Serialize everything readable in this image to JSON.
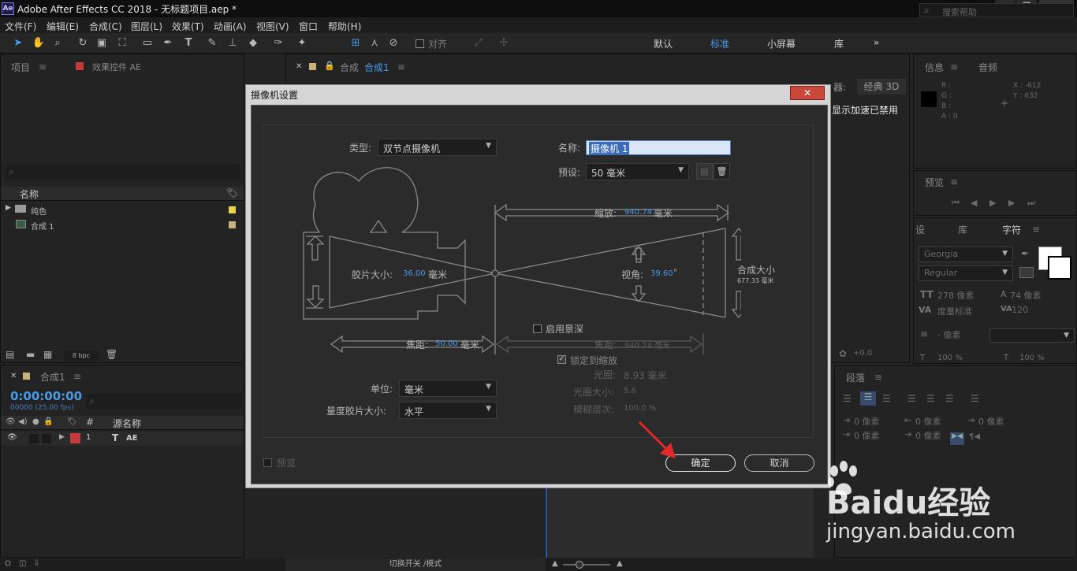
{
  "window": {
    "app_icon": "Ae",
    "title": "Adobe After Effects CC 2018 - 无标题项目.aep *",
    "min": "—",
    "max": "❐",
    "close": "✕"
  },
  "menu": [
    "文件(F)",
    "编辑(E)",
    "合成(C)",
    "图层(L)",
    "效果(T)",
    "动画(A)",
    "视图(V)",
    "窗口",
    "帮助(H)"
  ],
  "toolbar": {
    "align_label": "对齐",
    "workspaces": [
      "默认",
      "标准",
      "小屏幕",
      "库"
    ],
    "active_workspace": "标准",
    "more": "»",
    "search_placeholder": "搜索帮助"
  },
  "project_panel": {
    "tab_project": "项目",
    "tab_effects": "效果控件 AE",
    "col_name": "名称",
    "items": [
      {
        "name": "纯色",
        "type": "folder",
        "color": "#e8d44a"
      },
      {
        "name": "合成 1",
        "type": "comp",
        "color": "#c9b07c"
      }
    ],
    "bpc": "8 bpc"
  },
  "comp_panel": {
    "tab": "合成",
    "tab_name": "合成1",
    "renderer_label": "器:",
    "renderer": "经典 3D",
    "gpu_note": "显示加速已禁用"
  },
  "info_panel": {
    "tab_info": "信息",
    "tab_audio": "音频",
    "r": "R :",
    "g": "G :",
    "b": "B :",
    "a": "A : 0",
    "x": "X : -612",
    "y": "Y : 632"
  },
  "preview_panel": {
    "tab": "预览"
  },
  "char_panel": {
    "tab_left": "设",
    "tab_lib": "库",
    "tab_char": "字符",
    "font": "Georgia",
    "style": "Regular",
    "size": "278 像素",
    "leading": "74 像素",
    "kerning": "度量标准",
    "tracking": "120",
    "stroke": "- 像素",
    "vscale": "100 %",
    "hscale": "100 %",
    "baseline": "+0.0"
  },
  "para_panel": {
    "tab": "段落",
    "indent1": "0 像素",
    "indent2": "0 像素",
    "indent3": "0 像素",
    "space1": "0 像素",
    "space2": "0 像素"
  },
  "timeline": {
    "tab": "合成1",
    "timecode": "0:00:00:00",
    "frames": "00000 (25.00 fps)",
    "col_hash": "#",
    "col_source": "源名称",
    "layer_num": "1",
    "layer_name": "AE",
    "toggle_label": "切换开关 /模式"
  },
  "dialog": {
    "title": "摄像机设置",
    "close": "✕",
    "type_label": "类型:",
    "type_value": "双节点摄像机",
    "name_label": "名称:",
    "name_value": "摄像机 1",
    "preset_label": "预设:",
    "preset_value": "50 毫米",
    "zoom_label": "缩放:",
    "zoom_value": "940.74",
    "zoom_unit": "毫米",
    "film_label": "胶片大小:",
    "film_value": "36.00",
    "film_unit": "毫米",
    "angle_label": "视角:",
    "angle_value": "39.60",
    "angle_unit": "°",
    "comp_size_label": "合成大小",
    "comp_size_value": "677.33 毫米",
    "dof_label": "启用景深",
    "focal_label": "焦距:",
    "focal_value": "50.00",
    "focal_unit": "毫米",
    "focus_dist_label": "焦距:",
    "focus_dist_value": "940.74 毫米",
    "lock_label": "锁定到缩放",
    "aperture_label": "光圈:",
    "aperture_value": "8.93 毫米",
    "fstop_label": "光圈大小:",
    "fstop_value": "5.6",
    "blur_label": "模糊层次:",
    "blur_value": "100.0 %",
    "units_label": "单位:",
    "units_value": "毫米",
    "measure_label": "量度胶片大小:",
    "measure_value": "水平",
    "preview_label": "预览",
    "ok": "确定",
    "cancel": "取消"
  },
  "watermark": {
    "brand": "Baidu经验",
    "url": "jingyan.baidu.com"
  }
}
